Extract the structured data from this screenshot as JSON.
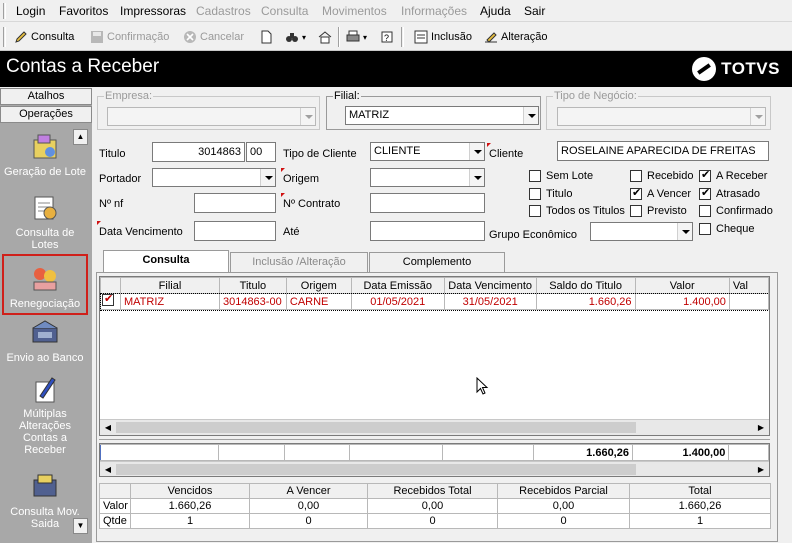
{
  "menu": {
    "items": [
      {
        "label": "Login",
        "enabled": true
      },
      {
        "label": "Favoritos",
        "enabled": true
      },
      {
        "label": "Impressoras",
        "enabled": true
      },
      {
        "label": "Cadastros",
        "enabled": false
      },
      {
        "label": "Consulta",
        "enabled": false
      },
      {
        "label": "Movimentos",
        "enabled": false
      },
      {
        "label": "Informações",
        "enabled": false
      },
      {
        "label": "Ajuda",
        "enabled": true
      },
      {
        "label": "Sair",
        "enabled": true
      }
    ]
  },
  "toolbar": {
    "consulta": "Consulta",
    "confirmacao": "Confirmação",
    "cancelar": "Cancelar",
    "inclusao": "Inclusão",
    "alteracao": "Alteração"
  },
  "header": {
    "title": "Contas a Receber",
    "logo": "TOTVS"
  },
  "sidebar": {
    "atalhos": "Atalhos",
    "operacoes": "Operações",
    "items": [
      {
        "label": "Geração de Lote",
        "icon": "lot-generation-icon"
      },
      {
        "label": "Consulta de Lotes",
        "icon": "lot-query-icon"
      },
      {
        "label": "Renegociação",
        "icon": "renegotiation-icon",
        "selected": true
      },
      {
        "label": "Envio ao Banco",
        "icon": "bank-send-icon"
      },
      {
        "label": "Múltiplas Alterações Contas a Receber",
        "icon": "multiple-changes-icon"
      },
      {
        "label": "Consulta Mov. Saida",
        "icon": "movement-query-icon"
      }
    ]
  },
  "filters": {
    "empresa_label": "Empresa:",
    "empresa_value": "",
    "filial_label": "Filial:",
    "filial_value": "MATRIZ",
    "tipo_negocio_label": "Tipo de Negócio:",
    "tipo_negocio_value": "",
    "titulo_label": "Titulo",
    "titulo_value": "3014863",
    "titulo_parcela": "00",
    "tipo_cliente_label": "Tipo de Cliente",
    "tipo_cliente_value": "CLIENTE",
    "cliente_label": "Cliente",
    "cliente_value": "ROSELAINE APARECIDA DE FREITAS",
    "portador_label": "Portador",
    "origem_label": "Origem",
    "nf_label": "Nº nf",
    "contrato_label": "Nº Contrato",
    "data_venc_label": "Data Vencimento",
    "ate_label": "Até",
    "grupo_label": "Grupo Econômico"
  },
  "checkboxes": [
    {
      "label": "Sem Lote",
      "checked": false
    },
    {
      "label": "Titulo",
      "checked": false
    },
    {
      "label": "Todos os Titulos",
      "checked": false
    },
    {
      "label": "Recebido",
      "checked": false
    },
    {
      "label": "A Vencer",
      "checked": true
    },
    {
      "label": "Previsto",
      "checked": false
    },
    {
      "label": "A Receber",
      "checked": true
    },
    {
      "label": "Atrasado",
      "checked": true
    },
    {
      "label": "Confirmado",
      "checked": false
    },
    {
      "label": "Cheque",
      "checked": false
    }
  ],
  "tabs": [
    {
      "label": "Consulta",
      "active": true
    },
    {
      "label": "Inclusão /Alteração",
      "active": false
    },
    {
      "label": "Complemento",
      "active": false
    }
  ],
  "grid": {
    "columns": [
      "Filial",
      "Titulo",
      "Origem",
      "Data Emissão",
      "Data Vencimento",
      "Saldo do Titulo",
      "Valor",
      "Val"
    ],
    "rows": [
      {
        "checked": true,
        "filial": "MATRIZ",
        "titulo": "3014863-00",
        "origem": "CARNE",
        "emissao": "01/05/2021",
        "vencimento": "31/05/2021",
        "saldo": "1.660,26",
        "valor": "1.400,00"
      }
    ],
    "totals": {
      "saldo": "1.660,26",
      "valor": "1.400,00"
    }
  },
  "summary": {
    "columns": [
      "Vencidos",
      "A Vencer",
      "Recebidos Total",
      "Recebidos Parcial",
      "Total"
    ],
    "rows": [
      {
        "label": "Valor",
        "values": [
          "1.660,26",
          "0,00",
          "0,00",
          "0,00",
          "1.660,26"
        ]
      },
      {
        "label": "Qtde",
        "values": [
          "1",
          "0",
          "0",
          "0",
          "1"
        ]
      }
    ]
  }
}
